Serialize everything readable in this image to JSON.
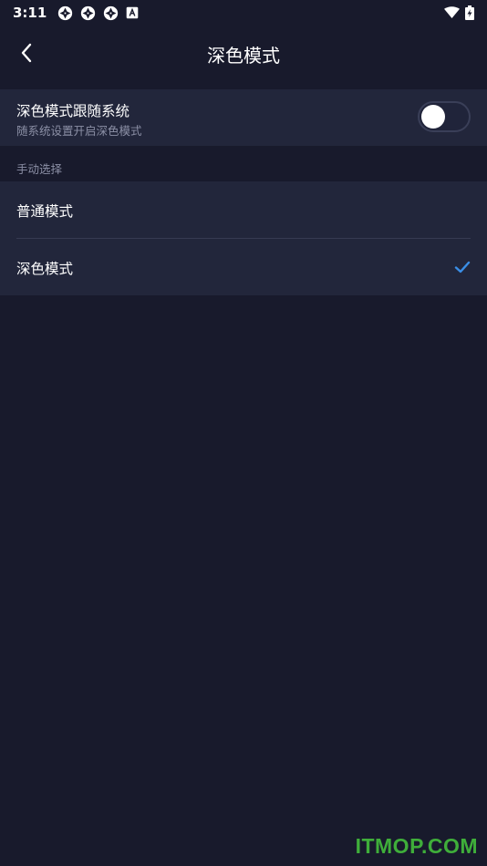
{
  "status_bar": {
    "time": "3:11",
    "notification_icons": [
      "aperture-icon",
      "aperture-icon",
      "aperture-icon",
      "a-badge-icon"
    ],
    "right_icons": [
      "wifi-icon",
      "battery-charging-icon"
    ]
  },
  "app_bar": {
    "back_icon": "chevron-left-icon",
    "title": "深色模式"
  },
  "follow_system": {
    "title": "深色模式跟随系统",
    "subtitle": "随系统设置开启深色模式",
    "enabled": false
  },
  "manual": {
    "section_label": "手动选择",
    "options": [
      {
        "label": "普通模式",
        "selected": false
      },
      {
        "label": "深色模式",
        "selected": true
      }
    ]
  },
  "colors": {
    "background": "#181a2c",
    "card": "#22263b",
    "accent": "#3a8ee6",
    "secondary_text": "#8c90a6"
  },
  "watermark": "ITMOP.COM"
}
